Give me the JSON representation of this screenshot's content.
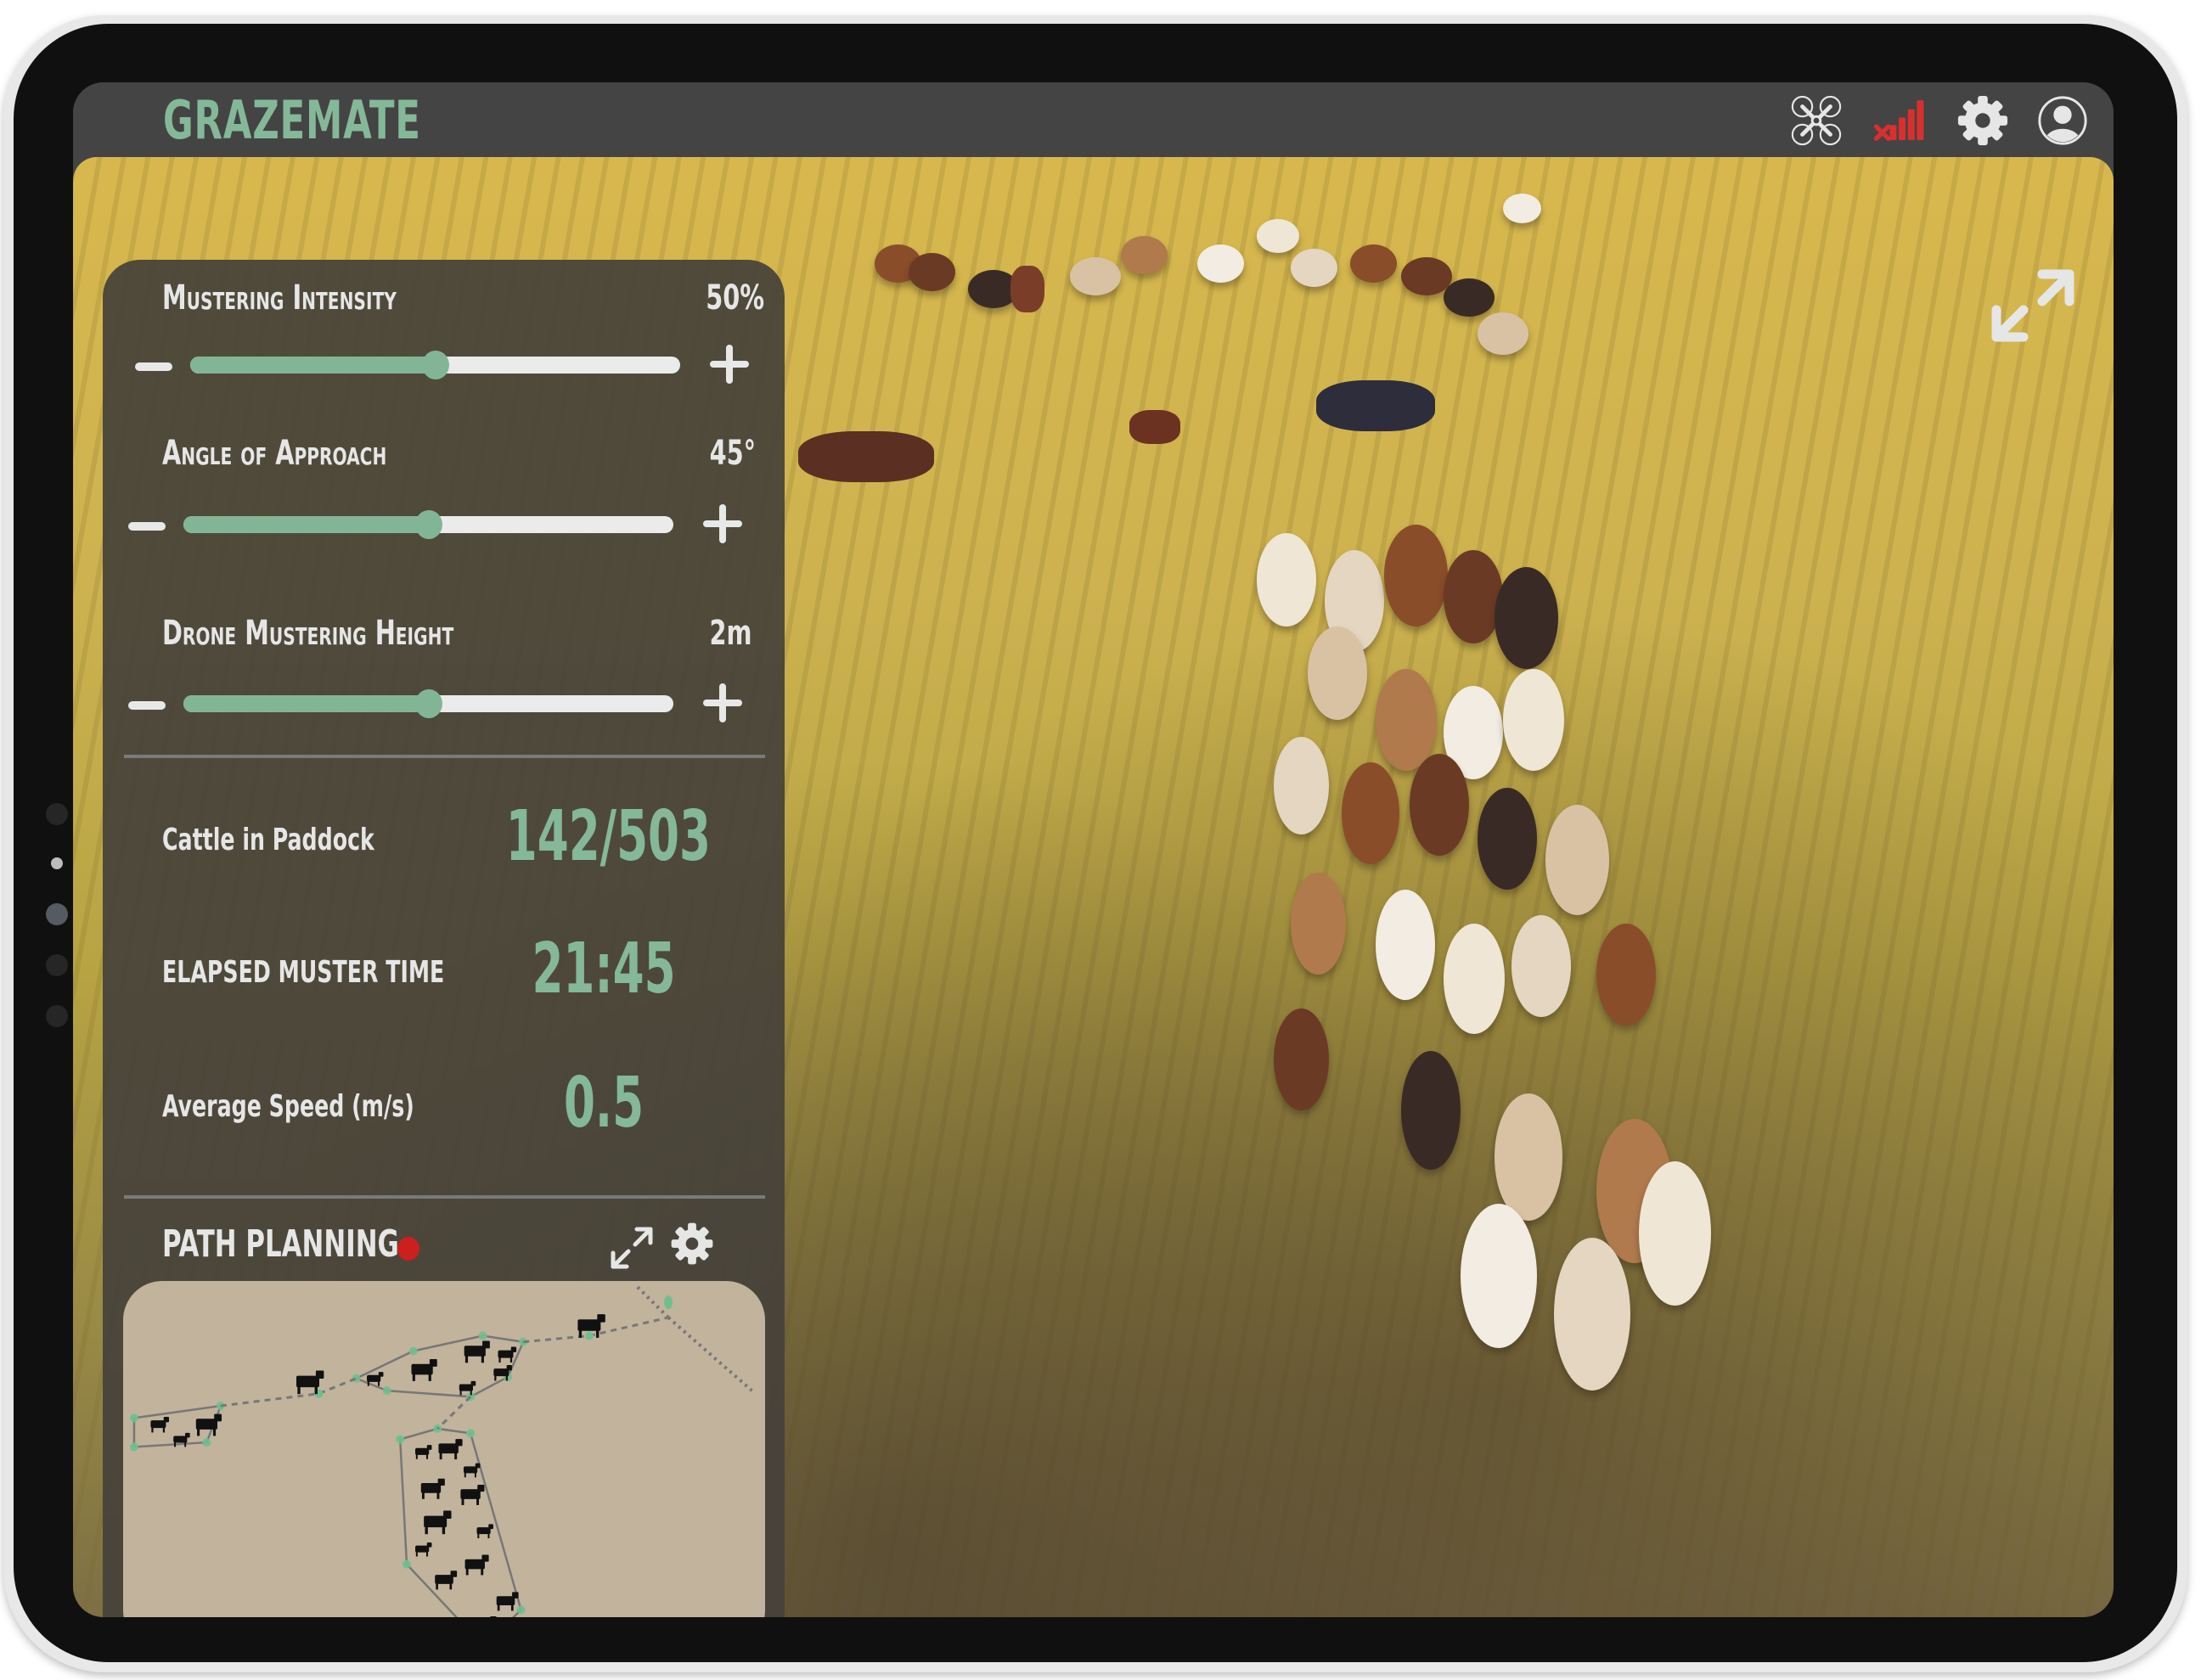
{
  "app": {
    "title": "GRAZEMATE",
    "brand_color": "#84b899"
  },
  "header": {
    "icons": [
      {
        "name": "drone-icon",
        "label": "Drone"
      },
      {
        "name": "signal-disconnected-icon",
        "label": "No signal",
        "color": "#d8302f"
      },
      {
        "name": "settings-icon",
        "label": "Settings"
      },
      {
        "name": "user-profile-icon",
        "label": "Profile"
      }
    ]
  },
  "video": {
    "expand_icon": "expand-icon"
  },
  "controls": {
    "sliders": [
      {
        "label": "Mustering Intensity",
        "value_text": "50%",
        "value_fraction": 0.5
      },
      {
        "label": "Angle of Approach",
        "value_text": "45°",
        "value_fraction": 0.5
      },
      {
        "label": "Drone Mustering Height",
        "value_text": "2m",
        "value_fraction": 0.5
      }
    ],
    "decrease_symbol": "−",
    "increase_symbol": "+"
  },
  "stats": [
    {
      "label": "Cattle in Paddock",
      "value": "142/503"
    },
    {
      "label": "ELAPSED MUSTER TIME",
      "value": "21:45"
    },
    {
      "label": "Average Speed (m/s)",
      "value": "0.5"
    }
  ],
  "path_planning": {
    "title": "PATH PLANNING",
    "status_color": "#cc1f1f",
    "status": "recording",
    "map": {
      "background": "#c2b39c",
      "groups": [
        {
          "name": "small-herd-west",
          "cattle_count": 3
        },
        {
          "name": "herd-north",
          "cattle_count": 7
        },
        {
          "name": "herd-south",
          "cattle_count": 13
        }
      ],
      "stray_cattle_count": 2
    }
  }
}
